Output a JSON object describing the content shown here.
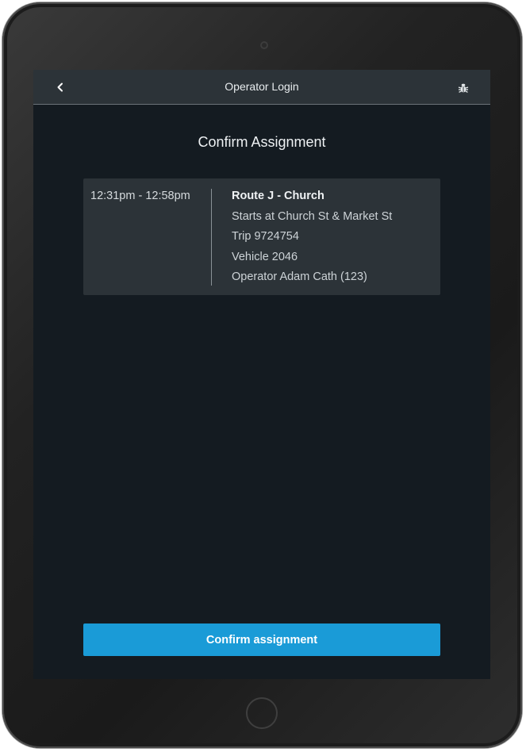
{
  "topbar": {
    "back_icon": "chevron-left-icon",
    "title": "Operator Login",
    "bug_icon": "bug-icon"
  },
  "page": {
    "heading": "Confirm Assignment"
  },
  "assignment": {
    "time_range": "12:31pm - 12:58pm",
    "route": "Route J - Church",
    "starts_at": "Starts at Church St & Market St",
    "trip": "Trip 9724754",
    "vehicle": "Vehicle 2046",
    "operator": "Operator Adam Cath (123)"
  },
  "actions": {
    "confirm_label": "Confirm assignment"
  },
  "colors": {
    "accent": "#1a9bd7",
    "background": "#141b21",
    "panel": "#2c3338"
  }
}
